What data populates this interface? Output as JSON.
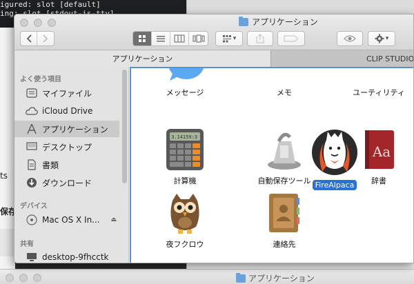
{
  "terminal": {
    "line1": "igured: slot [default]",
    "line2": "ing: slot [stdout-is-tty]"
  },
  "background": {
    "left_text_1": "ts",
    "left_text_2": "保存",
    "bottom_window_title": "アプリケーション"
  },
  "window": {
    "title": "アプリケーション"
  },
  "toolbar": {
    "back_icon": "chevron-left-icon",
    "forward_icon": "chevron-right-icon",
    "view_modes": [
      "icon-view",
      "list-view",
      "column-view",
      "coverflow-view"
    ],
    "active_view": "icon-view",
    "arrange_label": "▾",
    "share_icon": "share-icon",
    "tag_icon": "tag-icon",
    "quicklook_icon": "eye-icon",
    "action_icon": "gear-icon"
  },
  "tabs": [
    {
      "label": "アプリケーション",
      "active": true
    },
    {
      "label": "CLIP STUDIO",
      "active": false
    }
  ],
  "sidebar": {
    "favorites_header": "よく使う項目",
    "favorites": [
      {
        "label": "マイファイル",
        "icon": "all-files-icon"
      },
      {
        "label": "iCloud Drive",
        "icon": "cloud-icon"
      },
      {
        "label": "アプリケーション",
        "icon": "applications-icon",
        "selected": true
      },
      {
        "label": "デスクトップ",
        "icon": "desktop-icon"
      },
      {
        "label": "書類",
        "icon": "documents-icon"
      },
      {
        "label": "ダウンロード",
        "icon": "downloads-icon"
      }
    ],
    "devices_header": "デバイス",
    "devices": [
      {
        "label": "Mac OS X In...",
        "icon": "disk-icon",
        "eject": "⏏"
      }
    ],
    "shared_header": "共有",
    "shared": [
      {
        "label": "desktop-9fhcctk",
        "icon": "computer-icon"
      }
    ]
  },
  "apps": [
    {
      "label": "メッセージ",
      "icon": "messages-icon"
    },
    {
      "label": "メモ",
      "icon": "notes-icon"
    },
    {
      "label": "ユーティリティ",
      "icon": "utilities-folder-icon"
    },
    {
      "label": "計算機",
      "icon": "calculator-icon"
    },
    {
      "label": "自動保存ツール",
      "icon": "automator-icon"
    },
    {
      "label": "辞書",
      "icon": "dictionary-icon"
    },
    {
      "label": "夜フクロウ",
      "icon": "owl-icon"
    },
    {
      "label": "連絡先",
      "icon": "contacts-icon"
    }
  ],
  "dragged_app": {
    "label": "FireAlpaca",
    "icon": "firealpaca-icon"
  },
  "calculator_display": "3.14159:3",
  "dictionary_text": "Aa",
  "colors": {
    "selection_blue": "#2d6fd6",
    "focus_ring": "#4f93dd"
  }
}
